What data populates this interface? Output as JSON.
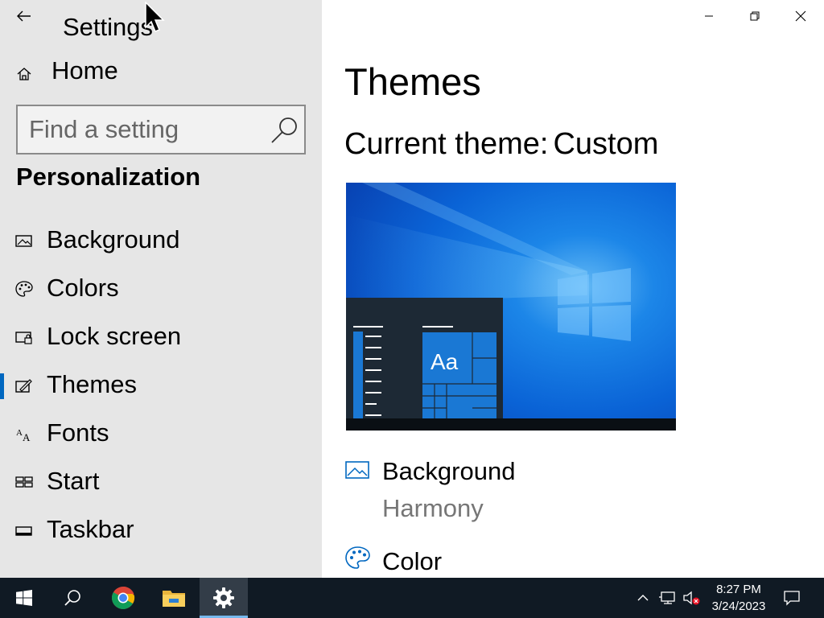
{
  "window": {
    "title": "Settings",
    "controls": {
      "minimize": "minimize",
      "maximize": "restore",
      "close": "close"
    }
  },
  "sidebar": {
    "home_label": "Home",
    "search_placeholder": "Find a setting",
    "section_title": "Personalization",
    "items": [
      {
        "label": "Background",
        "icon": "picture-icon",
        "active": false
      },
      {
        "label": "Colors",
        "icon": "palette-icon",
        "active": false
      },
      {
        "label": "Lock screen",
        "icon": "lock-screen-icon",
        "active": false
      },
      {
        "label": "Themes",
        "icon": "themes-icon",
        "active": true
      },
      {
        "label": "Fonts",
        "icon": "fonts-icon",
        "active": false
      },
      {
        "label": "Start",
        "icon": "start-icon",
        "active": false
      },
      {
        "label": "Taskbar",
        "icon": "taskbar-icon",
        "active": false
      }
    ]
  },
  "main": {
    "page_title": "Themes",
    "current_theme_label": "Current theme:",
    "current_theme_value": "Custom",
    "preview_sample_text": "Aa",
    "settings": [
      {
        "name": "Background",
        "value": "Harmony",
        "icon": "picture-icon"
      },
      {
        "name": "Color",
        "value": "",
        "icon": "palette-icon"
      }
    ]
  },
  "taskbar": {
    "apps": [
      {
        "name": "start-button",
        "icon": "windows-logo-icon"
      },
      {
        "name": "search-button",
        "icon": "search-icon"
      },
      {
        "name": "chrome-button",
        "icon": "chrome-icon"
      },
      {
        "name": "file-explorer-button",
        "icon": "folder-icon"
      },
      {
        "name": "settings-button",
        "icon": "gear-icon",
        "active": true
      }
    ],
    "time": "8:27 PM",
    "date": "3/24/2023"
  },
  "colors": {
    "accent": "#0067c0",
    "sidebar_bg": "#e6e6e6",
    "taskbar_bg": "#101a24",
    "secondary_text": "#767676"
  }
}
